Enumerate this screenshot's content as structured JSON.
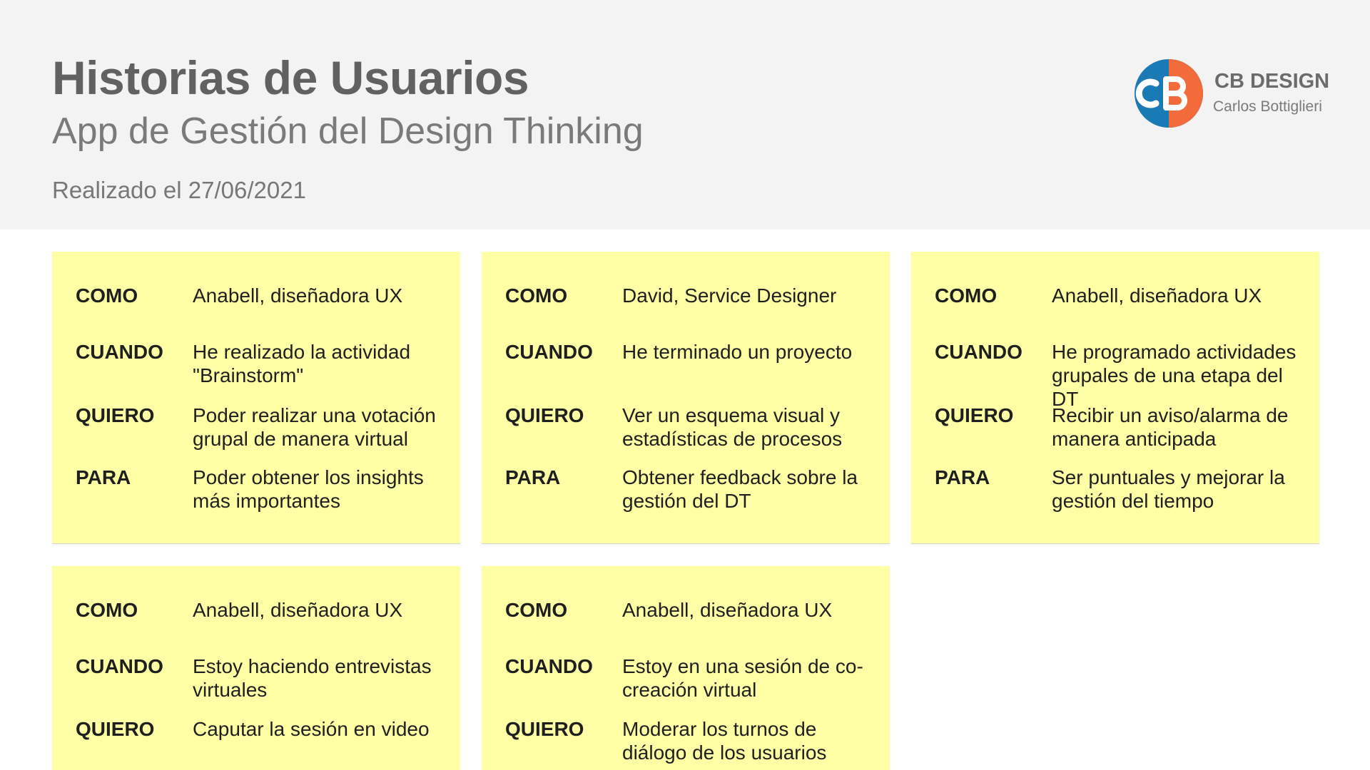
{
  "header": {
    "title": "Historias de Usuarios",
    "subtitle": "App de Gestión del Design Thinking",
    "date": "Realizado el 27/06/2021"
  },
  "brand": {
    "name": "CB DESIGN",
    "author": "Carlos Bottiglieri",
    "logo_icon": "cb-logo-icon",
    "colors": {
      "orange": "#f26b3a",
      "blue": "#1a7ab5"
    }
  },
  "cards": [
    {
      "como_label": "COMO",
      "como": "Anabell, diseñadora UX",
      "cuando_label": "CUANDO",
      "cuando": "He realizado la actividad \"Brainstorm\"",
      "quiero_label": "QUIERO",
      "quiero": "Poder realizar una votación grupal de manera virtual",
      "para_label": "PARA",
      "para": "Poder obtener los insights más importantes"
    },
    {
      "como_label": "COMO",
      "como": "David, Service Designer",
      "cuando_label": "CUANDO",
      "cuando": "He terminado un proyecto",
      "quiero_label": "QUIERO",
      "quiero": "Ver un esquema visual y estadísticas de procesos",
      "para_label": "PARA",
      "para": "Obtener feedback sobre la gestión del DT"
    },
    {
      "como_label": "COMO",
      "como": "Anabell, diseñadora UX",
      "cuando_label": "CUANDO",
      "cuando": "He programado actividades grupales de una etapa del DT",
      "quiero_label": "QUIERO",
      "quiero": "Recibir un aviso/alarma de manera anticipada",
      "para_label": "PARA",
      "para": "Ser puntuales y mejorar la gestión del tiempo"
    },
    {
      "como_label": "COMO",
      "como": "Anabell, diseñadora UX",
      "cuando_label": "CUANDO",
      "cuando": "Estoy haciendo entrevistas virtuales",
      "quiero_label": "QUIERO",
      "quiero": "Caputar la sesión en video"
    },
    {
      "como_label": "COMO",
      "como": "Anabell, diseñadora UX",
      "cuando_label": "CUANDO",
      "cuando": "Estoy en una sesión de co-creación virtual",
      "quiero_label": "QUIERO",
      "quiero": "Moderar los turnos de diálogo de los usuarios"
    }
  ],
  "colors": {
    "header_bg": "#f3f3f3",
    "card_bg": "#ffffa5",
    "title": "#616161"
  }
}
